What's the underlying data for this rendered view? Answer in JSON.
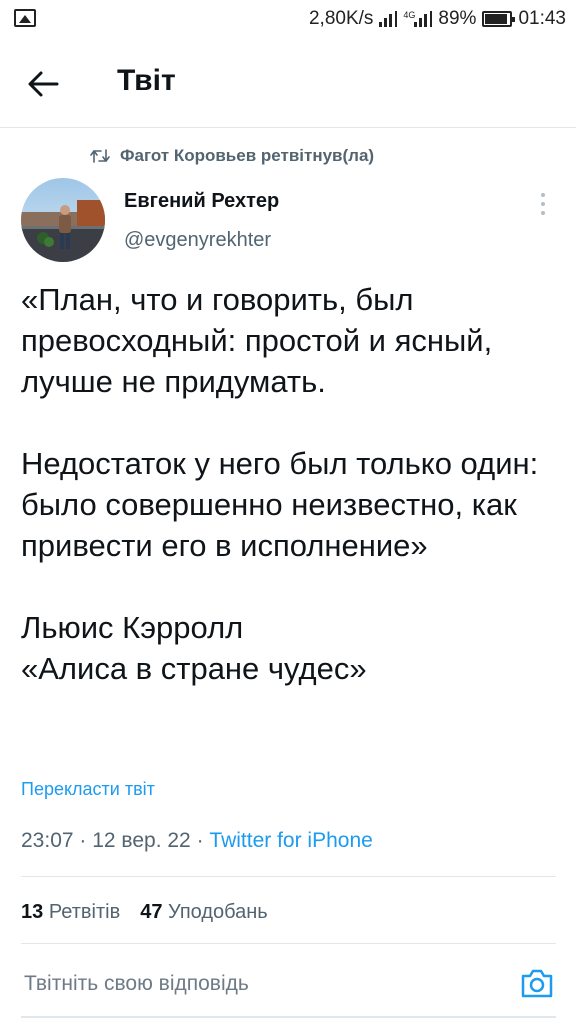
{
  "status_bar": {
    "speed": "2,80K/s",
    "battery": "89%",
    "battery_level": 0.89,
    "time": "01:43"
  },
  "header": {
    "title": "Твіт"
  },
  "retweet": {
    "text": "Фагот Коровьев ретвітнув(ла)"
  },
  "author": {
    "name": "Евгений Рехтер",
    "handle": "@evgenyrekhter"
  },
  "tweet": {
    "paragraphs": [
      "«План, что и говорить, был превосходный: простой и ясный, лучше не придумать.",
      "Недостаток у него был только один: было совершенно неизвестно, как привести его в исполнение»",
      "Льюис Кэрролл",
      "«Алиса в стране чудес»"
    ]
  },
  "translate": "Перекласти твіт",
  "meta": {
    "time": "23:07",
    "date": "12 вер. 22",
    "source": "Twitter for iPhone"
  },
  "stats": {
    "retweets_count": "13",
    "retweets_label": "Ретвітів",
    "likes_count": "47",
    "likes_label": "Уподобань"
  },
  "reply": {
    "placeholder": "Твітніть свою відповідь"
  },
  "colors": {
    "accent": "#1d9bf0",
    "text": "#0f1419",
    "secondary": "#536471",
    "divider": "#e1e8ed"
  }
}
